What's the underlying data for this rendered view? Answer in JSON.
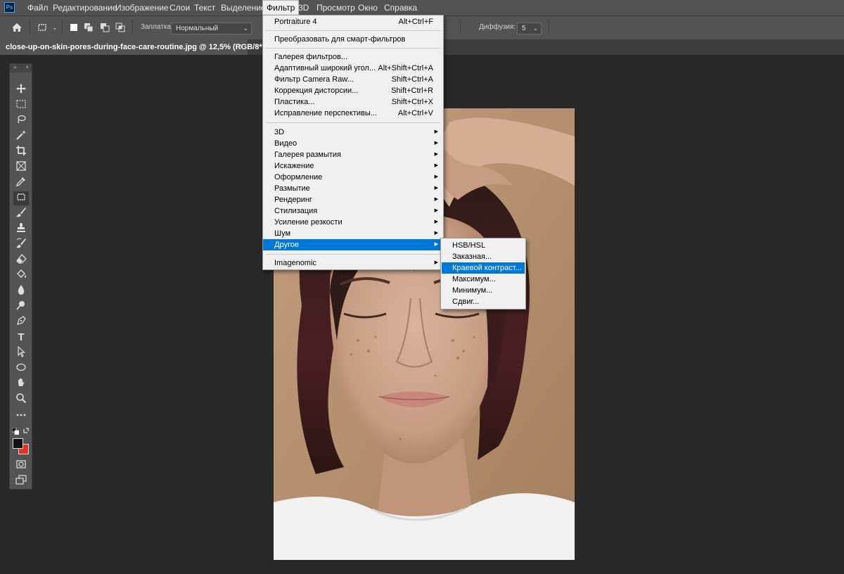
{
  "app": {
    "logo_text": "Ps"
  },
  "menubar": {
    "items": [
      "Файл",
      "Редактирование",
      "Изображение",
      "Слои",
      "Текст",
      "Выделение",
      "Фильтр",
      "3D",
      "Просмотр",
      "Окно",
      "Справка"
    ],
    "open_item": "Фильтр"
  },
  "options_bar": {
    "patch_label": "Заплатка:",
    "patch_mode": "Нормальный",
    "diffusion_label": "Диффузия:",
    "diffusion_value": "5"
  },
  "document_tab": {
    "title": "close-up-on-skin-pores-during-face-care-routine.jpg @ 12,5% (RGB/8*) *",
    "close_glyph": "×"
  },
  "toolbox": {
    "tools": [
      "move-tool",
      "marquee-tool",
      "lasso-tool",
      "magic-wand-tool",
      "crop-tool",
      "frame-tool",
      "eyedropper-tool",
      "patch-tool",
      "brush-tool",
      "stamp-tool",
      "history-brush-tool",
      "eraser-tool",
      "paint-bucket-tool",
      "blur-tool",
      "dodge-tool",
      "pen-tool",
      "type-tool",
      "path-selection-tool",
      "ellipse-tool",
      "hand-tool",
      "zoom-tool",
      "more-tools"
    ],
    "type_tool_glyph": "T",
    "foreground_color": "#111111",
    "background_color": "#e53221"
  },
  "filter_menu": {
    "top": [
      {
        "label": "Portraiture 4",
        "shortcut": "Alt+Ctrl+F"
      },
      {
        "label": "Преобразовать для смарт-фильтров",
        "shortcut": ""
      }
    ],
    "group2": [
      {
        "label": "Галерея фильтров...",
        "shortcut": ""
      },
      {
        "label": "Адаптивный широкий угол...",
        "shortcut": "Alt+Shift+Ctrl+A"
      },
      {
        "label": "Фильтр Camera Raw...",
        "shortcut": "Shift+Ctrl+A"
      },
      {
        "label": "Коррекция дисторсии...",
        "shortcut": "Shift+Ctrl+R"
      },
      {
        "label": "Пластика...",
        "shortcut": "Shift+Ctrl+X"
      },
      {
        "label": "Исправление перспективы...",
        "shortcut": "Alt+Ctrl+V"
      }
    ],
    "group3": [
      {
        "label": "3D"
      },
      {
        "label": "Видео"
      },
      {
        "label": "Галерея размытия"
      },
      {
        "label": "Искажение"
      },
      {
        "label": "Оформление"
      },
      {
        "label": "Размытие"
      },
      {
        "label": "Рендеринг"
      },
      {
        "label": "Стилизация"
      },
      {
        "label": "Усиление резкости"
      },
      {
        "label": "Шум"
      },
      {
        "label": "Другое"
      }
    ],
    "group4": [
      {
        "label": "Imagenomic"
      }
    ],
    "highlighted": "Другое",
    "submenu_arrow": "▶"
  },
  "other_submenu": {
    "items": [
      "HSB/HSL",
      "Заказная...",
      "Краевой контраст...",
      "Максимум...",
      "Минимум...",
      "Сдвиг..."
    ],
    "highlighted": "Краевой контраст..."
  },
  "colors": {
    "highlight": "#0078d7",
    "ui_panel": "#535353",
    "workspace": "#282828"
  }
}
